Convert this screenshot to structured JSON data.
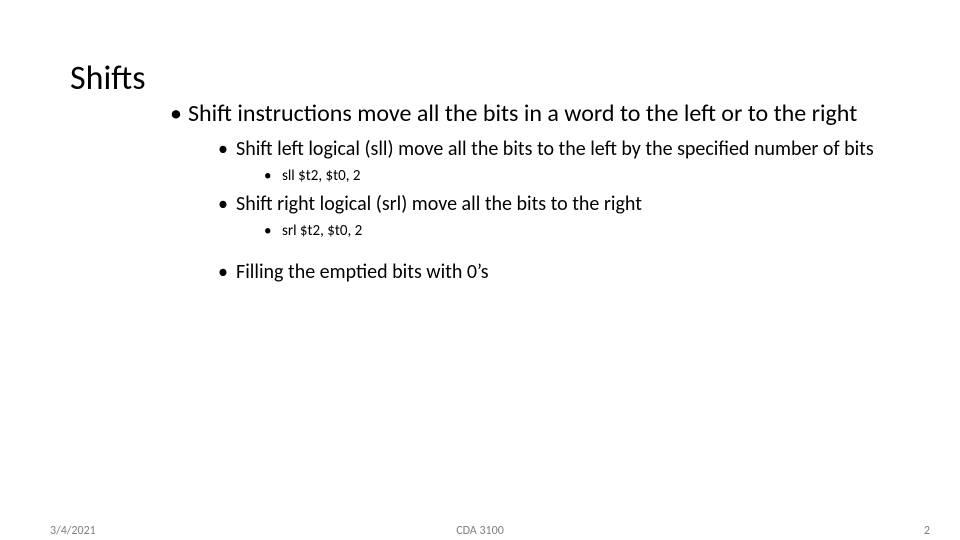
{
  "title": "Shifts",
  "bullets": {
    "b1": "Shift instructions move all the bits in a word to the left or to the right",
    "b1_1": "Shift left logical (sll) move all the bits to the left by the specified number of bits",
    "b1_1_1": "sll $t2, $t0, 2",
    "b1_2": "Shift right logical (srl) move all the bits to the right",
    "b1_2_1": "srl $t2, $t0, 2",
    "b1_3": "Filling the emptied bits with 0’s"
  },
  "footer": {
    "date": "3/4/2021",
    "course": "CDA 3100",
    "page": "2"
  }
}
